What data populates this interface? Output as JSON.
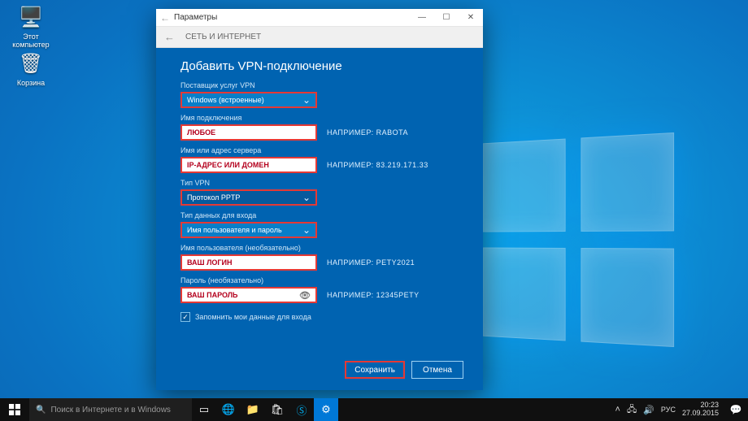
{
  "desktop": {
    "icons": [
      {
        "label": "Этот\nкомпьютер"
      },
      {
        "label": "Корзина"
      }
    ]
  },
  "window": {
    "app_title": "Параметры",
    "breadcrumb": "СЕТЬ И ИНТЕРНЕТ",
    "panel_title": "Добавить VPN-подключение",
    "fields": {
      "provider": {
        "label": "Поставщик услуг VPN",
        "value": "Windows (встроенные)"
      },
      "conn_name": {
        "label": "Имя подключения",
        "placeholder": "ЛЮБОЕ",
        "hint": "НАПРИМЕР: RABOTA"
      },
      "server": {
        "label": "Имя или адрес сервера",
        "placeholder": "IP-АДРЕС ИЛИ ДОМЕН",
        "hint": "НАПРИМЕР: 83.219.171.33"
      },
      "vpn_type": {
        "label": "Тип VPN",
        "value": "Протокол PPTP"
      },
      "signin_type": {
        "label": "Тип данных для входа",
        "value": "Имя пользователя и пароль"
      },
      "username": {
        "label": "Имя пользователя (необязательно)",
        "placeholder": "ВАШ ЛОГИН",
        "hint": "НАПРИМЕР: PETY2021"
      },
      "password": {
        "label": "Пароль (необязательно)",
        "placeholder": "ВАШ ПАРОЛЬ",
        "hint": "НАПРИМЕР: 12345PETY"
      }
    },
    "remember_label": "Запомнить мои данные для входа",
    "actions": {
      "save": "Сохранить",
      "cancel": "Отмена"
    }
  },
  "taskbar": {
    "search_placeholder": "Поиск в Интернете и в Windows",
    "lang": "РУС",
    "time": "20:23",
    "date": "27.09.2015"
  }
}
